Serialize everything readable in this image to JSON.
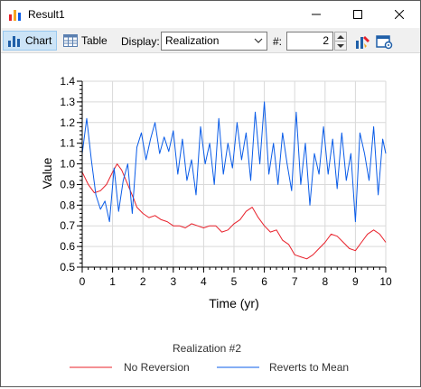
{
  "window": {
    "title": "Result1"
  },
  "toolbar": {
    "chart_label": "Chart",
    "table_label": "Table",
    "display_label": "Display:",
    "display_value": "Realization",
    "number_label": "#:",
    "number_value": "2"
  },
  "icons": {
    "app": "bar-chart-icon",
    "minimize": "minimize-icon",
    "maximize": "maximize-icon",
    "close": "close-icon",
    "chart": "bar-chart-icon",
    "table": "table-icon",
    "chevron": "chevron-down-icon",
    "properties": "chart-properties-icon",
    "settings": "settings-icon"
  },
  "colors": {
    "no_reversion": "#e8202a",
    "reverts_to_mean": "#0a5ce8",
    "grid": "#d9d9d9",
    "accent_toolbar": "#cce4f7"
  },
  "chart_data": {
    "type": "line",
    "xlabel": "Time (yr)",
    "ylabel": "Value",
    "xlim": [
      0,
      10
    ],
    "ylim": [
      0.5,
      1.4
    ],
    "xticks": [
      0,
      1,
      2,
      3,
      4,
      5,
      6,
      7,
      8,
      9,
      10
    ],
    "yticks": [
      0.5,
      0.6,
      0.7,
      0.8,
      0.9,
      1.0,
      1.1,
      1.2,
      1.3,
      1.4
    ],
    "grid": true,
    "legend_title": "Realization #2",
    "legend_position": "bottom",
    "series": [
      {
        "name": "No Reversion",
        "color": "#e8202a",
        "x": [
          0,
          0.2,
          0.4,
          0.6,
          0.8,
          1.0,
          1.15,
          1.3,
          1.5,
          1.7,
          1.8,
          2.0,
          2.2,
          2.4,
          2.6,
          2.8,
          3.0,
          3.2,
          3.4,
          3.6,
          3.8,
          4.0,
          4.2,
          4.4,
          4.6,
          4.8,
          5.0,
          5.2,
          5.4,
          5.6,
          5.8,
          6.0,
          6.2,
          6.4,
          6.6,
          6.8,
          7.0,
          7.2,
          7.4,
          7.6,
          7.8,
          8.0,
          8.2,
          8.4,
          8.6,
          8.8,
          9.0,
          9.2,
          9.4,
          9.6,
          9.8,
          10.0
        ],
        "y": [
          0.96,
          0.9,
          0.86,
          0.87,
          0.9,
          0.96,
          1.0,
          0.97,
          0.9,
          0.83,
          0.79,
          0.76,
          0.74,
          0.75,
          0.73,
          0.72,
          0.7,
          0.7,
          0.69,
          0.71,
          0.7,
          0.69,
          0.7,
          0.7,
          0.67,
          0.68,
          0.71,
          0.73,
          0.77,
          0.79,
          0.74,
          0.7,
          0.67,
          0.68,
          0.63,
          0.61,
          0.56,
          0.55,
          0.54,
          0.56,
          0.59,
          0.62,
          0.66,
          0.65,
          0.62,
          0.59,
          0.58,
          0.62,
          0.66,
          0.68,
          0.66,
          0.62
        ]
      },
      {
        "name": "Reverts to Mean",
        "color": "#0a5ce8",
        "x": [
          0,
          0.15,
          0.3,
          0.45,
          0.6,
          0.75,
          0.9,
          1.05,
          1.2,
          1.35,
          1.5,
          1.65,
          1.8,
          1.95,
          2.1,
          2.25,
          2.4,
          2.55,
          2.7,
          2.85,
          3.0,
          3.15,
          3.3,
          3.45,
          3.6,
          3.75,
          3.9,
          4.05,
          4.2,
          4.35,
          4.5,
          4.65,
          4.8,
          4.95,
          5.1,
          5.25,
          5.4,
          5.55,
          5.7,
          5.85,
          6.0,
          6.15,
          6.3,
          6.45,
          6.6,
          6.75,
          6.9,
          7.05,
          7.2,
          7.35,
          7.5,
          7.65,
          7.8,
          7.95,
          8.1,
          8.25,
          8.4,
          8.55,
          8.7,
          8.85,
          9.0,
          9.15,
          9.3,
          9.45,
          9.6,
          9.75,
          9.9,
          10.0
        ],
        "y": [
          1.05,
          1.22,
          1.02,
          0.85,
          0.78,
          0.82,
          0.72,
          0.98,
          0.77,
          0.92,
          1.0,
          0.76,
          1.08,
          1.15,
          1.02,
          1.12,
          1.2,
          1.05,
          1.13,
          1.06,
          1.16,
          0.95,
          1.12,
          0.92,
          1.02,
          0.85,
          1.18,
          1.0,
          1.1,
          0.9,
          1.22,
          0.95,
          1.1,
          0.98,
          1.2,
          1.02,
          1.15,
          0.92,
          1.25,
          1.0,
          1.3,
          0.95,
          1.1,
          0.9,
          1.15,
          1.0,
          0.87,
          1.25,
          0.9,
          1.1,
          0.8,
          1.05,
          0.95,
          1.18,
          0.95,
          1.12,
          0.88,
          1.15,
          0.92,
          1.05,
          0.72,
          1.15,
          1.05,
          0.92,
          1.18,
          0.85,
          1.12,
          1.05
        ]
      }
    ]
  }
}
